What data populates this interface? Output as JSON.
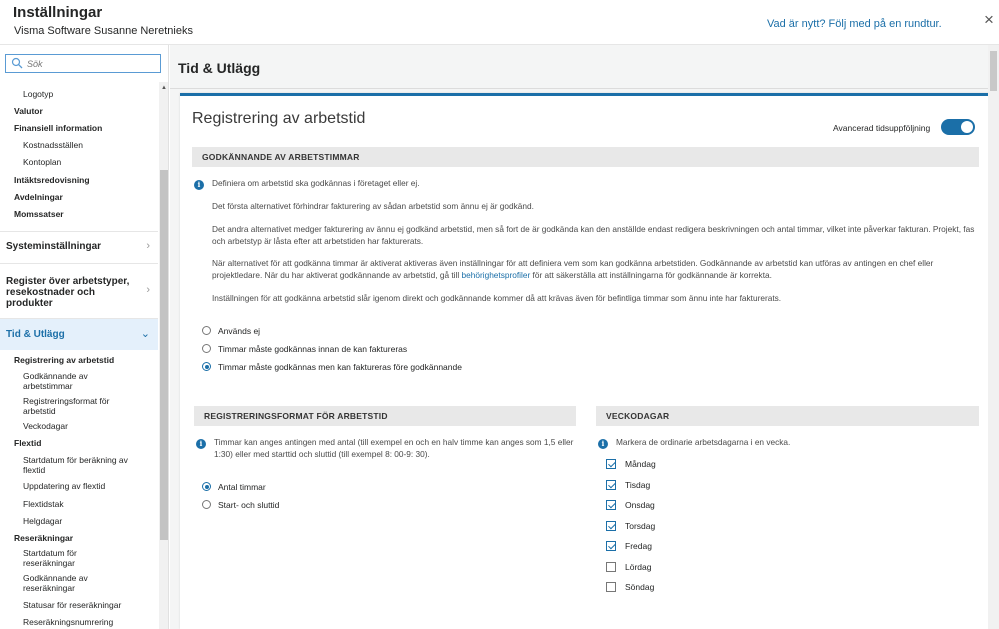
{
  "header": {
    "title": "Inställningar",
    "subtitle": "Visma Software Susanne Neretnieks",
    "whats_new": "Vad är nytt? Följ med på en rundtur.",
    "close": "×"
  },
  "sidebar": {
    "search_placeholder": "Sök",
    "items": [
      {
        "label": "Logotyp"
      },
      {
        "label": "Valutor"
      },
      {
        "label": "Finansiell information"
      },
      {
        "label": "Kostnadsställen"
      },
      {
        "label": "Kontoplan"
      },
      {
        "label": "Intäktsredovisning"
      },
      {
        "label": "Avdelningar"
      },
      {
        "label": "Momssatser"
      }
    ],
    "sections": [
      {
        "label": "Systeminställningar"
      },
      {
        "label": "Register över arbetstyper, resekostnader och produkter"
      },
      {
        "label": "Tid & Utlägg"
      }
    ],
    "sub_items": [
      {
        "label": "Registrering av arbetstid"
      },
      {
        "label": "Godkännande av arbetstimmar"
      },
      {
        "label": "Registreringsformat för arbetstid"
      },
      {
        "label": "Veckodagar"
      },
      {
        "label": "Flextid"
      },
      {
        "label": "Startdatum för beräkning av flextid"
      },
      {
        "label": "Uppdatering av flextid"
      },
      {
        "label": "Flextidstak"
      },
      {
        "label": "Helgdagar"
      },
      {
        "label": "Reseräkningar"
      },
      {
        "label": "Startdatum för reseräkningar"
      },
      {
        "label": "Godkännande av reseräkningar"
      },
      {
        "label": "Statusar för reseräkningar"
      },
      {
        "label": "Reseräkningsnumrering"
      }
    ]
  },
  "main": {
    "page_title": "Tid & Utlägg",
    "card_title": "Registrering av arbetstid",
    "toggle_label": "Avancerad tidsuppföljning",
    "toggle_on": true,
    "approval": {
      "header": "Godkännande av arbetstimmar",
      "p1": "Definiera om arbetstid ska godkännas i företaget eller ej.",
      "p2": "Det första alternativet förhindrar fakturering av sådan arbetstid som ännu ej är godkänd.",
      "p3": "Det andra alternativet medger fakturering av ännu ej godkänd arbetstid, men så fort de är godkända kan den anställde endast redigera beskrivningen och antal timmar, vilket inte påverkar fakturan. Projekt, fas och arbetstyp är låsta efter att arbetstiden har fakturerats.",
      "p4_a": "När alternativet för att godkänna timmar är aktiverat aktiveras även inställningar för att definiera vem som kan godkänna arbetstiden. Godkännande av arbetstid kan utföras av antingen en chef eller projektledare. När du har aktiverat godkännande av arbetstid, gå till ",
      "p4_link": "behörighetsprofiler",
      "p4_b": " för att säkerställa att inställningarna för godkännande är korrekta.",
      "p5": "Inställningen för att godkänna arbetstid slår igenom direkt och godkännande kommer då att krävas även för befintliga timmar som ännu inte har fakturerats.",
      "options": [
        {
          "label": "Används ej",
          "checked": false
        },
        {
          "label": "Timmar måste godkännas innan de kan faktureras",
          "checked": false
        },
        {
          "label": "Timmar måste godkännas men kan faktureras före godkännande",
          "checked": true
        }
      ]
    },
    "format": {
      "header": "Registreringsformat för arbetstid",
      "info": "Timmar kan anges antingen med antal (till exempel en och en halv timme kan anges som 1,5 eller 1:30) eller med starttid och sluttid (till exempel 8: 00-9: 30).",
      "options": [
        {
          "label": "Antal timmar",
          "checked": true
        },
        {
          "label": "Start- och sluttid",
          "checked": false
        }
      ]
    },
    "weekdays": {
      "header": "Veckodagar",
      "info": "Markera de ordinarie arbetsdagarna i en vecka.",
      "days": [
        {
          "label": "Måndag",
          "checked": true
        },
        {
          "label": "Tisdag",
          "checked": true
        },
        {
          "label": "Onsdag",
          "checked": true
        },
        {
          "label": "Torsdag",
          "checked": true
        },
        {
          "label": "Fredag",
          "checked": true
        },
        {
          "label": "Lördag",
          "checked": false
        },
        {
          "label": "Söndag",
          "checked": false
        }
      ]
    }
  },
  "colors": {
    "accent": "#1b6fa8",
    "active_bg": "#e4f0fb"
  }
}
